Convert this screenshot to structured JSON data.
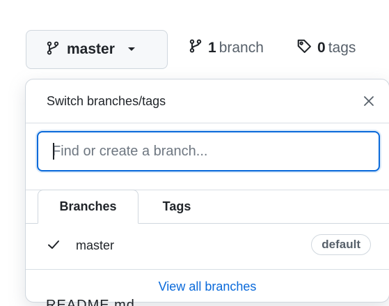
{
  "branch_selector": {
    "current_branch": "master",
    "icon": "git-branch-icon"
  },
  "stats": {
    "branches_count": "1",
    "branches_label": "branch",
    "tags_count": "0",
    "tags_label": "tags"
  },
  "dropdown": {
    "title": "Switch branches/tags",
    "close_icon": "close-icon",
    "filter_placeholder": "Find or create a branch...",
    "tabs": [
      {
        "label": "Branches",
        "selected": true
      },
      {
        "label": "Tags",
        "selected": false
      }
    ],
    "branches": [
      {
        "name": "master",
        "checked": true,
        "badge": "default"
      }
    ],
    "footer_link": "View all branches"
  },
  "underlying": {
    "partial_text": "README.md"
  },
  "colors": {
    "accent": "#0969da",
    "border": "#d0d7de",
    "button_bg": "#f6f8fa",
    "text": "#1f2328",
    "muted": "#57606a"
  }
}
